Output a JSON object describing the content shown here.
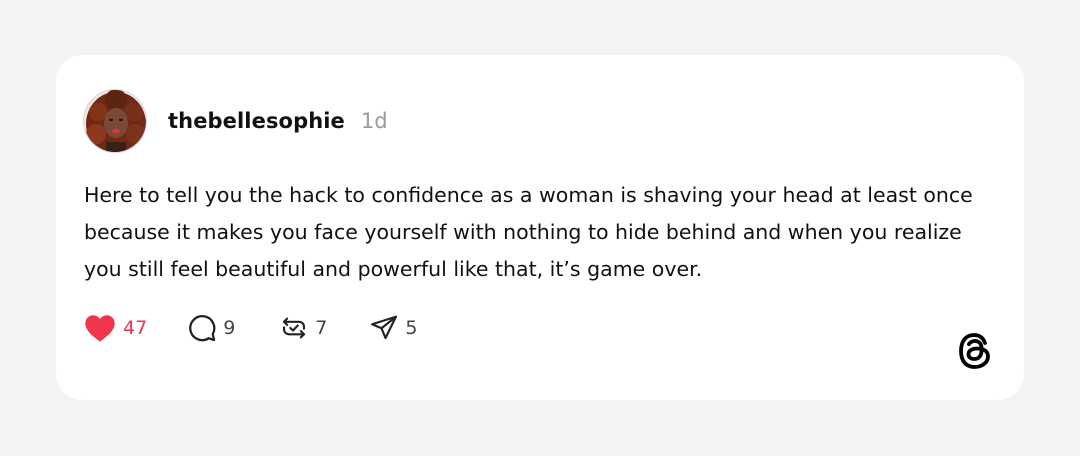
{
  "post": {
    "username": "thebellesophie",
    "time": "1d",
    "text": "Here to tell you the hack to confidence as a woman is shaving your head at least once because it makes you face yourself with nothing to hide behind and when you realize you still feel beautiful and powerful like that, it’s game over."
  },
  "actions": {
    "likes": "47",
    "replies": "9",
    "reposts": "7",
    "shares": "5"
  },
  "icons": {
    "like": "heart-icon",
    "reply": "comment-icon",
    "repost": "repost-icon",
    "share": "send-icon",
    "brand": "threads-logo-icon"
  },
  "colors": {
    "like_active": "#f0364d",
    "background": "#f3f3f3",
    "card": "#ffffff",
    "muted": "#9a9a9a"
  }
}
